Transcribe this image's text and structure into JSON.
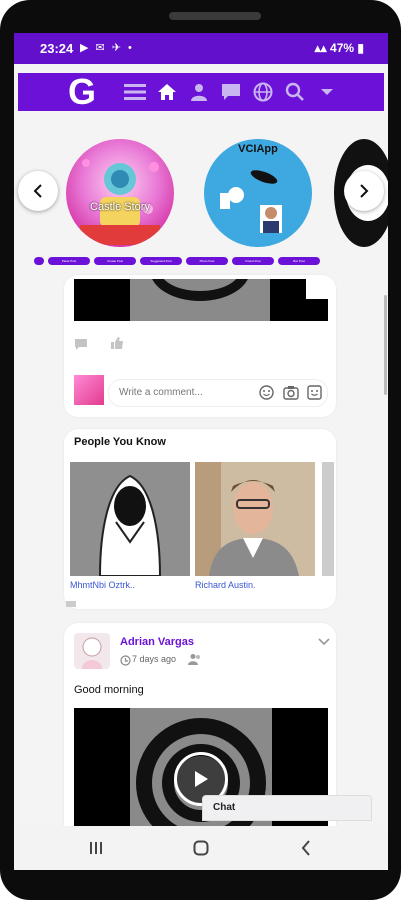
{
  "status_bar": {
    "time": "23:24",
    "left_icons": "▶ ✉ ✈ •",
    "battery": "47%"
  },
  "app_bar": {
    "logo": "G",
    "nav_icons": [
      "menu-icon",
      "home-icon",
      "user-icon",
      "chat-icon",
      "globe-icon",
      "search-icon",
      "chevron-down-icon"
    ]
  },
  "stories": {
    "items": [
      {
        "label": "Castle Story"
      },
      {
        "label": "VCIApp"
      }
    ],
    "tabs": [
      "Paste Post",
      "Create Post",
      "Suggested Post",
      "Photo Post",
      "Friend Post",
      "Bar Post"
    ]
  },
  "comment_box": {
    "placeholder": "Write a comment..."
  },
  "people_you_know": {
    "title": "People You Know",
    "people": [
      {
        "name": "MhmtNbi Oztrk.."
      },
      {
        "name": "Richard Austin."
      }
    ]
  },
  "post": {
    "author": "Adrian Vargas",
    "time": "7 days ago",
    "text": "Good morning"
  },
  "chat": {
    "label": "Chat"
  },
  "colors": {
    "brand": "#6c12d8",
    "status_bar": "#6210cc",
    "link": "#3a56d4"
  }
}
